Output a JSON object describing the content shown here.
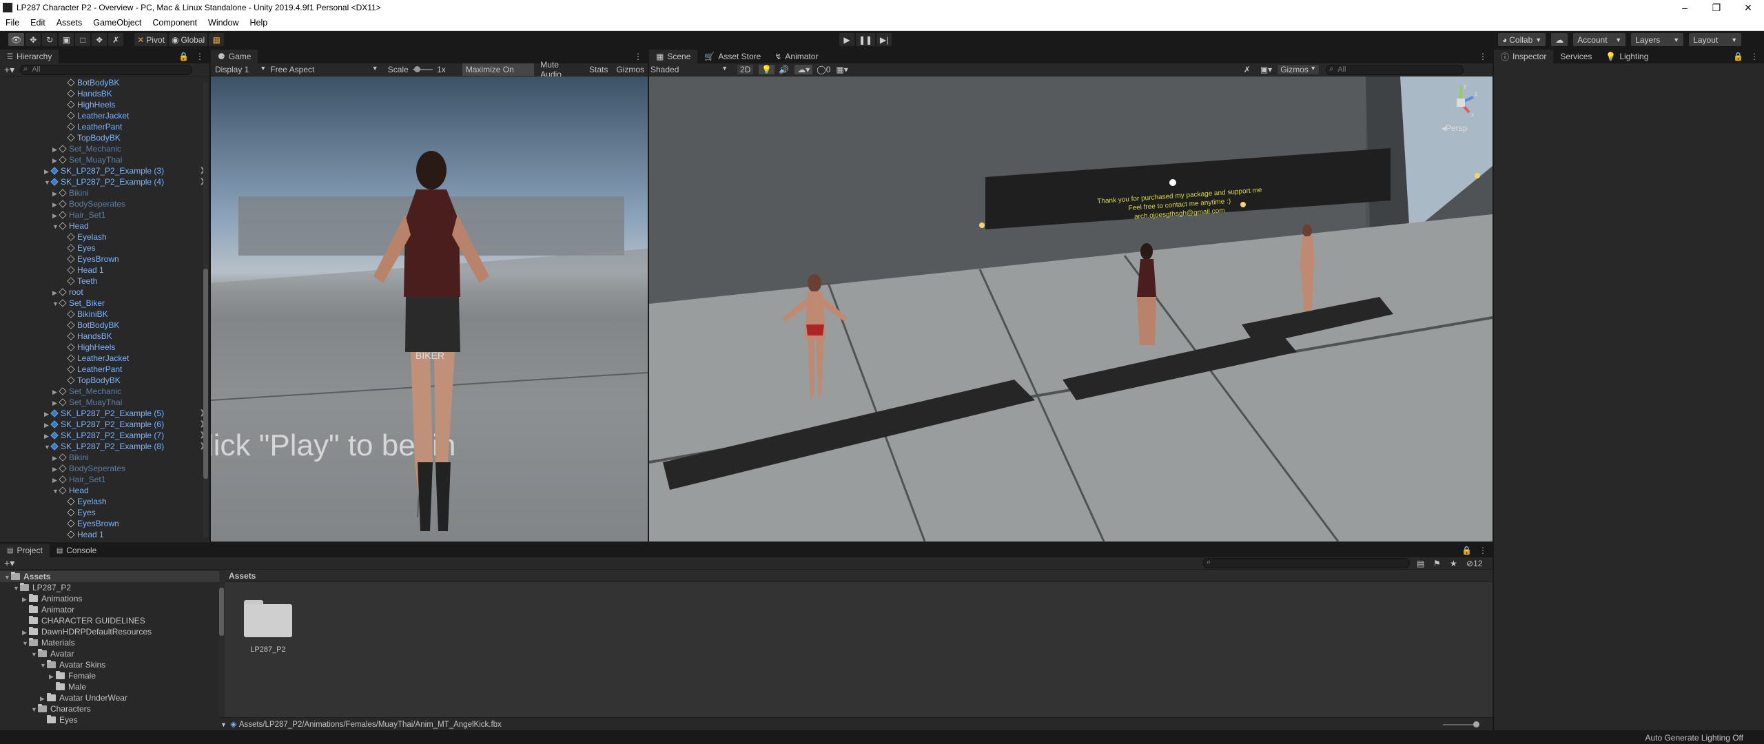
{
  "window": {
    "title": "LP287 Character P2 - Overview - PC, Mac & Linux Standalone - Unity 2019.4.9f1 Personal <DX11>"
  },
  "menu": [
    "File",
    "Edit",
    "Assets",
    "GameObject",
    "Component",
    "Window",
    "Help"
  ],
  "toolbar": {
    "pivot": "Pivot",
    "global": "Global",
    "collab": "Collab",
    "account": "Account",
    "layers": "Layers",
    "layout": "Layout"
  },
  "hierarchy": {
    "tab": "Hierarchy",
    "search_placeholder": "All",
    "rows": [
      {
        "label": "BotBodyBK",
        "indent": 5,
        "state": "blue"
      },
      {
        "label": "HandsBK",
        "indent": 5,
        "state": "blue"
      },
      {
        "label": "HighHeels",
        "indent": 5,
        "state": "blue"
      },
      {
        "label": "LeatherJacket",
        "indent": 5,
        "state": "blue"
      },
      {
        "label": "LeatherPant",
        "indent": 5,
        "state": "blue"
      },
      {
        "label": "TopBodyBK",
        "indent": 5,
        "state": "blue"
      },
      {
        "label": "Set_Mechanic",
        "indent": 4,
        "state": "dim",
        "fold": "▶"
      },
      {
        "label": "Set_MuayThai",
        "indent": 4,
        "state": "dim",
        "fold": "▶"
      },
      {
        "label": "SK_LP287_P2_Example (3)",
        "indent": 3,
        "state": "prefab",
        "fold": "▶",
        "more": true
      },
      {
        "label": "SK_LP287_P2_Example (4)",
        "indent": 3,
        "state": "prefab",
        "fold": "▼",
        "more": true
      },
      {
        "label": "Bikini",
        "indent": 4,
        "state": "dim",
        "fold": "▶"
      },
      {
        "label": "BodySeperates",
        "indent": 4,
        "state": "dim",
        "fold": "▶"
      },
      {
        "label": "Hair_Set1",
        "indent": 4,
        "state": "dim",
        "fold": "▶"
      },
      {
        "label": "Head",
        "indent": 4,
        "state": "blue",
        "fold": "▼"
      },
      {
        "label": "Eyelash",
        "indent": 5,
        "state": "blue"
      },
      {
        "label": "Eyes",
        "indent": 5,
        "state": "blue"
      },
      {
        "label": "EyesBrown",
        "indent": 5,
        "state": "blue"
      },
      {
        "label": "Head 1",
        "indent": 5,
        "state": "blue"
      },
      {
        "label": "Teeth",
        "indent": 5,
        "state": "blue"
      },
      {
        "label": "root",
        "indent": 4,
        "state": "blue",
        "fold": "▶"
      },
      {
        "label": "Set_Biker",
        "indent": 4,
        "state": "blue",
        "fold": "▼"
      },
      {
        "label": "BikiniBK",
        "indent": 5,
        "state": "blue"
      },
      {
        "label": "BotBodyBK",
        "indent": 5,
        "state": "blue"
      },
      {
        "label": "HandsBK",
        "indent": 5,
        "state": "blue"
      },
      {
        "label": "HighHeels",
        "indent": 5,
        "state": "blue"
      },
      {
        "label": "LeatherJacket",
        "indent": 5,
        "state": "blue"
      },
      {
        "label": "LeatherPant",
        "indent": 5,
        "state": "blue"
      },
      {
        "label": "TopBodyBK",
        "indent": 5,
        "state": "blue"
      },
      {
        "label": "Set_Mechanic",
        "indent": 4,
        "state": "dim",
        "fold": "▶"
      },
      {
        "label": "Set_MuayThai",
        "indent": 4,
        "state": "dim",
        "fold": "▶"
      },
      {
        "label": "SK_LP287_P2_Example (5)",
        "indent": 3,
        "state": "prefab",
        "fold": "▶",
        "more": true
      },
      {
        "label": "SK_LP287_P2_Example (6)",
        "indent": 3,
        "state": "prefab",
        "fold": "▶",
        "more": true
      },
      {
        "label": "SK_LP287_P2_Example (7)",
        "indent": 3,
        "state": "prefab",
        "fold": "▶",
        "more": true
      },
      {
        "label": "SK_LP287_P2_Example (8)",
        "indent": 3,
        "state": "prefab",
        "fold": "▼",
        "more": true
      },
      {
        "label": "Bikini",
        "indent": 4,
        "state": "dim",
        "fold": "▶"
      },
      {
        "label": "BodySeperates",
        "indent": 4,
        "state": "dim",
        "fold": "▶"
      },
      {
        "label": "Hair_Set1",
        "indent": 4,
        "state": "dim",
        "fold": "▶"
      },
      {
        "label": "Head",
        "indent": 4,
        "state": "blue",
        "fold": "▼"
      },
      {
        "label": "Eyelash",
        "indent": 5,
        "state": "blue"
      },
      {
        "label": "Eyes",
        "indent": 5,
        "state": "blue"
      },
      {
        "label": "EyesBrown",
        "indent": 5,
        "state": "blue"
      },
      {
        "label": "Head 1",
        "indent": 5,
        "state": "blue"
      }
    ]
  },
  "game": {
    "tab": "Game",
    "display": "Display 1",
    "aspect": "Free Aspect",
    "scale_label": "Scale",
    "scale_value": "1x",
    "maximize": "Maximize On Play",
    "mute": "Mute Audio",
    "stats": "Stats",
    "gizmos": "Gizmos",
    "floor_text": "lick \"Play\" to begin",
    "shorts_text": "BIKER"
  },
  "scene": {
    "tabs": [
      "Scene",
      "Asset Store",
      "Animator"
    ],
    "shading": "Shaded",
    "mode2d": "2D",
    "fx_count": "0",
    "gizmos": "Gizmos",
    "search_placeholder": "All",
    "persp": "Persp",
    "axis_y": "y",
    "axis_z": "z",
    "axis_x": "x",
    "sign_line1": "Thank you for purchased my package and support me",
    "sign_line2": "Feel free to contact me anytime :)",
    "sign_line3": "arch.ojoesgthsgh@gmail.com"
  },
  "inspector": {
    "tabs": [
      "Inspector",
      "Services",
      "Lighting"
    ]
  },
  "project": {
    "tabs": [
      "Project",
      "Console"
    ],
    "add": "+",
    "tree": [
      {
        "label": "Assets",
        "indent": 0,
        "fold": "▼",
        "bold": true
      },
      {
        "label": "LP287_P2",
        "indent": 1,
        "fold": "▼"
      },
      {
        "label": "Animations",
        "indent": 2,
        "fold": "▶"
      },
      {
        "label": "Animator",
        "indent": 2,
        "fold": ""
      },
      {
        "label": "CHARACTER GUIDELINES",
        "indent": 2,
        "fold": ""
      },
      {
        "label": "DawnHDRPDefaultResources",
        "indent": 2,
        "fold": "▶"
      },
      {
        "label": "Materials",
        "indent": 2,
        "fold": "▼"
      },
      {
        "label": "Avatar",
        "indent": 3,
        "fold": "▼"
      },
      {
        "label": "Avatar Skins",
        "indent": 4,
        "fold": "▼"
      },
      {
        "label": "Female",
        "indent": 5,
        "fold": "▶"
      },
      {
        "label": "Male",
        "indent": 5,
        "fold": ""
      },
      {
        "label": "Avatar UnderWear",
        "indent": 4,
        "fold": "▶"
      },
      {
        "label": "Characters",
        "indent": 3,
        "fold": "▼"
      },
      {
        "label": "Eyes",
        "indent": 4,
        "fold": ""
      }
    ],
    "breadcrumb": "Assets",
    "folder_name": "LP287_P2",
    "path": "Assets/LP287_P2/Animations/Females/MuayThai/Anim_MT_AngelKick.fbx",
    "hidden_count": "12"
  },
  "status": {
    "right": "Auto Generate Lighting Off"
  }
}
